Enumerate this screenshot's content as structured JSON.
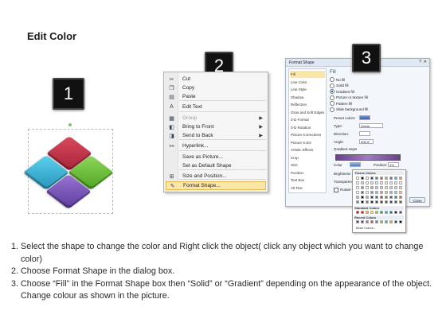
{
  "title": "Edit Color",
  "steps": {
    "badge1": "1",
    "badge2": "2",
    "badge3": "3"
  },
  "shape": {
    "tiles": [
      {
        "name": "red-tile",
        "color": "#c0304a"
      },
      {
        "name": "blue-tile",
        "color": "#3ab4d8"
      },
      {
        "name": "green-tile",
        "color": "#6cbf3c"
      },
      {
        "name": "purple-tile",
        "color": "#7a52b8"
      }
    ]
  },
  "context_menu": {
    "items": [
      {
        "label": "Cut",
        "icon": "scissors-icon",
        "disabled": false,
        "submenu": false
      },
      {
        "label": "Copy",
        "icon": "copy-icon",
        "disabled": false,
        "submenu": false
      },
      {
        "label": "Paste",
        "icon": "paste-icon",
        "disabled": false,
        "submenu": false
      },
      {
        "label": "Edit Text",
        "icon": "edit-text-icon",
        "disabled": false,
        "submenu": false
      },
      {
        "label": "Group",
        "icon": "group-icon",
        "disabled": true,
        "submenu": true
      },
      {
        "label": "Bring to Front",
        "icon": "bring-front-icon",
        "disabled": false,
        "submenu": true
      },
      {
        "label": "Send to Back",
        "icon": "send-back-icon",
        "disabled": false,
        "submenu": true
      },
      {
        "label": "Hyperlink...",
        "icon": "hyperlink-icon",
        "disabled": false,
        "submenu": false
      },
      {
        "label": "Save as Picture...",
        "icon": "",
        "disabled": false,
        "submenu": false
      },
      {
        "label": "Set as Default Shape",
        "icon": "",
        "disabled": false,
        "submenu": false
      },
      {
        "label": "Size and Position...",
        "icon": "size-icon",
        "disabled": false,
        "submenu": false
      },
      {
        "label": "Format Shape...",
        "icon": "format-shape-icon",
        "disabled": false,
        "submenu": false,
        "highlighted": true
      }
    ]
  },
  "format_dialog": {
    "title": "Format Shape",
    "nav": [
      "Fill",
      "Line Color",
      "Line Style",
      "Shadow",
      "Reflection",
      "Glow and Soft Edges",
      "3-D Format",
      "3-D Rotation",
      "Picture Corrections",
      "Picture Color",
      "Artistic Effects",
      "Crop",
      "Size",
      "Position",
      "Text Box",
      "Alt Text"
    ],
    "fill_heading": "Fill",
    "fill_options": [
      "No fill",
      "Solid fill",
      "Gradient fill",
      "Picture or texture fill",
      "Pattern fill",
      "Slide background fill"
    ],
    "selected_fill": "Gradient fill",
    "preset_colors_label": "Preset colors:",
    "type_label": "Type:",
    "type_value": "Linear",
    "direction_label": "Direction:",
    "angle_label": "Angle:",
    "angle_value": "306.9°",
    "gradient_stops_label": "Gradient stops",
    "color_label": "Color",
    "position_label": "Position:",
    "position_value": "0%",
    "brightness_label": "Brightness",
    "transparency_label": "Transparency",
    "rotate_label": "Rotate with shape",
    "close_button": "Close",
    "palette": {
      "theme_label": "Theme Colors",
      "standard_label": "Standard Colors",
      "recent_label": "Recent Colors",
      "more_label": "More Colors..."
    }
  },
  "instructions": [
    "Select the shape to change the color and Right click the object( click any object which you want to change color)",
    "Choose Format Shape in the dialog box.",
    "Choose “Fill” in the Format Shape box then “Solid” or “Gradient” depending on the appearance of the object. Change colour as shown in the picture."
  ]
}
